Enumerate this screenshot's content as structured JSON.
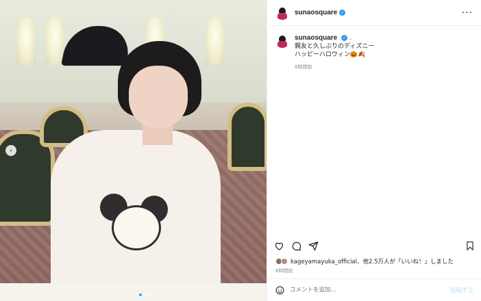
{
  "post": {
    "username": "sunaosquare",
    "caption_lines": [
      ".",
      "親友と久しぶりのディズニー",
      "ハッピーハロウィン🎃🍂"
    ],
    "caption_time": "8時間前",
    "likes_text": "kageyamayuka_official、他2.5万人が「いいね！」しました",
    "post_time": "8時間前",
    "comment_placeholder": "コメントを追加...",
    "post_label": "投稿する",
    "more_label": "···"
  },
  "carousel": {
    "total": 5,
    "current": 2
  },
  "colors": {
    "accent": "#3897f0",
    "border": "#efefef",
    "muted": "#8e8e8e",
    "post_disabled": "#b2dffc"
  },
  "icons": [
    "chevron-left-icon",
    "more-icon",
    "verified-icon",
    "heart-icon",
    "comment-icon",
    "share-icon",
    "bookmark-icon",
    "emoji-icon"
  ]
}
